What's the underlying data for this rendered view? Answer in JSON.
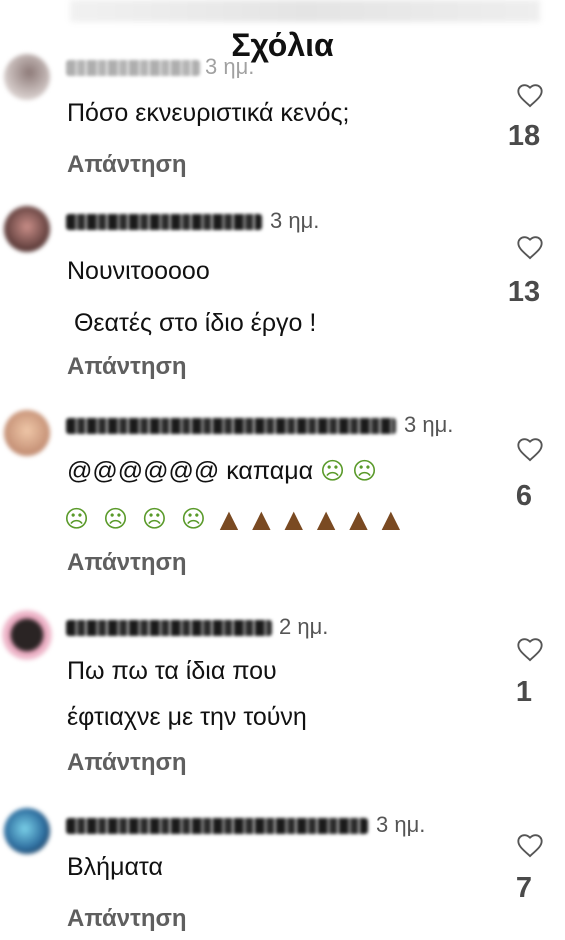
{
  "header": {
    "title": "Σχόλια"
  },
  "comments": [
    {
      "time": "3 ημ.",
      "lines": [
        "Πόσο εκνευριστικά κενός;"
      ],
      "reply_label": "Απάντηση",
      "likes": "18",
      "avatar_color": "#c9bdbb"
    },
    {
      "time": "3 ημ.",
      "lines": [
        "Νουνιτοοοοο",
        " Θεατές στο ίδιο έργο !"
      ],
      "reply_label": "Απάντηση",
      "likes": "13",
      "avatar_color": "#7a5552"
    },
    {
      "time": "3 ημ.",
      "lines": [
        "@@@@@@ καπαμα",
        ""
      ],
      "reply_label": "Απάντηση",
      "likes": "6",
      "avatar_color": "#d9a98e",
      "emoji": {
        "line1": [
          "nauseated-face",
          "nauseated-face"
        ],
        "line2": [
          "nauseated-face",
          "nauseated-face",
          "nauseated-face",
          "nauseated-face",
          "pile-of-poo",
          "pile-of-poo",
          "pile-of-poo",
          "pile-of-poo",
          "pile-of-poo",
          "pile-of-poo"
        ]
      }
    },
    {
      "time": "2 ημ.",
      "lines": [
        "Πω πω τα ίδια που",
        "έφτιαχνε με την τούνη"
      ],
      "reply_label": "Απάντηση",
      "likes": "1",
      "avatar_color": "#3a3030"
    },
    {
      "time": "3 ημ.",
      "lines": [
        "Βλήματα"
      ],
      "reply_label": "Απάντηση",
      "likes": "7",
      "avatar_color": "#2f6fa0"
    }
  ],
  "icons": {
    "like": "heart-outline-icon"
  }
}
